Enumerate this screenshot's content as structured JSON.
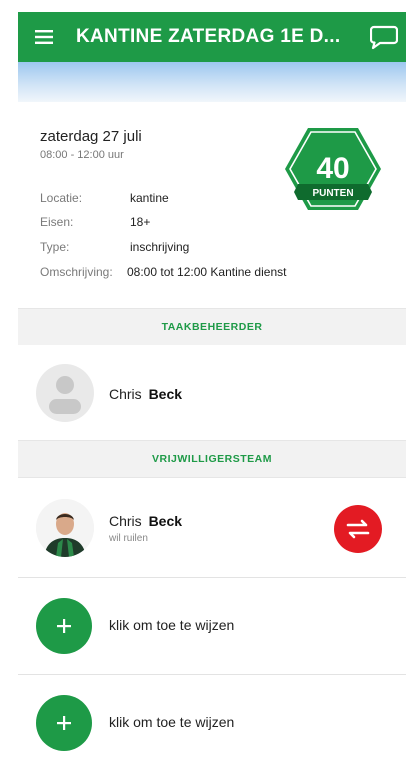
{
  "header": {
    "title": "KANTINE ZATERDAG 1E D...",
    "menu_icon": "hamburger-menu-icon",
    "chat_icon": "chat-bubble-icon",
    "color": "#1e9a47"
  },
  "task": {
    "date": "zaterdag 27 juli",
    "time": "08:00 - 12:00 uur",
    "points": "40",
    "points_label": "PUNTEN",
    "details": [
      {
        "label": "Locatie:",
        "value": "kantine"
      },
      {
        "label": "Eisen:",
        "value": "18+"
      },
      {
        "label": "Type:",
        "value": "inschrijving"
      },
      {
        "label": "Omschrijving:",
        "value": "08:00 tot 12:00 Kantine dienst"
      }
    ]
  },
  "manager_section": {
    "title": "TAAKBEHEERDER",
    "first_name": "Chris",
    "last_name": "Beck"
  },
  "team_section": {
    "title": "VRIJWILLIGERSTEAM",
    "member": {
      "first_name": "Chris",
      "last_name": "Beck",
      "status": "wil ruilen",
      "swap_icon": "swap-arrows-icon"
    },
    "assign_slots": [
      {
        "label": "klik om toe te wijzen"
      },
      {
        "label": "klik om toe te wijzen"
      }
    ]
  },
  "colors": {
    "accent": "#1e9a47",
    "swap": "#e31b23"
  }
}
